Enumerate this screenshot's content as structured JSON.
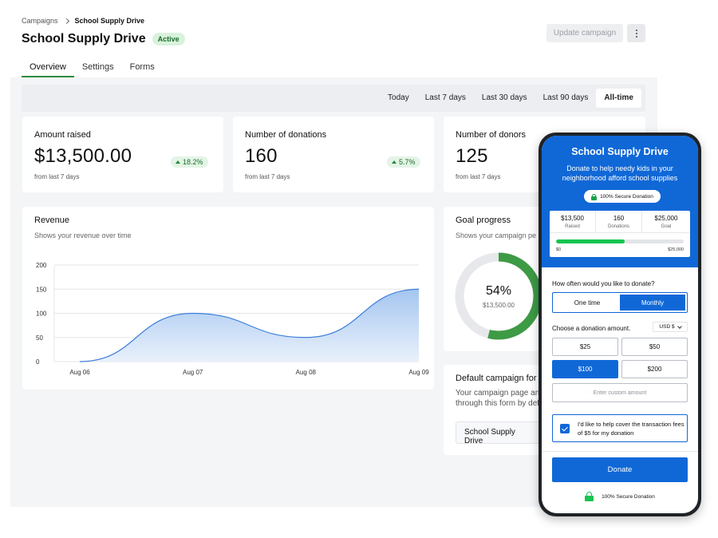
{
  "breadcrumb": {
    "parent": "Campaigns",
    "current": "School Supply Drive"
  },
  "header": {
    "title": "School Supply Drive",
    "status": "Active",
    "update_label": "Update campaign"
  },
  "tabs": [
    {
      "label": "Overview"
    },
    {
      "label": "Settings"
    },
    {
      "label": "Forms"
    }
  ],
  "date_ranges": [
    {
      "label": "Today"
    },
    {
      "label": "Last 7 days"
    },
    {
      "label": "Last 30 days"
    },
    {
      "label": "Last 90 days"
    },
    {
      "label": "All-time"
    }
  ],
  "date_range_selected": "All-time",
  "stats": [
    {
      "label": "Amount raised",
      "value": "$13,500.00",
      "change": "18.2%",
      "sub": "from last 7 days"
    },
    {
      "label": "Number of donations",
      "value": "160",
      "change": "5.7%",
      "sub": "from last 7 days"
    },
    {
      "label": "Number of donors",
      "value": "125",
      "sub": "from last 7 days"
    }
  ],
  "revenue": {
    "title": "Revenue",
    "subtitle": "Shows your revenue over time"
  },
  "chart_data": {
    "type": "area",
    "x": [
      "Aug 06",
      "Aug 07",
      "Aug 08",
      "Aug 09"
    ],
    "series": [
      {
        "values": [
          0,
          100,
          50,
          150
        ]
      }
    ],
    "ylim": [
      0,
      200
    ],
    "yticks": [
      0,
      50,
      100,
      150,
      200
    ],
    "grid": true,
    "color": "#3d7fd9"
  },
  "goal": {
    "title": "Goal progress",
    "subtitle": "Shows your campaign pe",
    "percent_label": "54%",
    "percent": 54,
    "amount": "$13,500.00",
    "color": "#3d9a45"
  },
  "default_form": {
    "title": "Default campaign for",
    "desc_line1": "Your campaign page and",
    "desc_line2": "through this form by defa",
    "selected": "School Supply Drive"
  },
  "donation_form": {
    "title": "School Supply Drive",
    "description": "Donate to help needy kids in your neighborhood afford school supplies",
    "secure_badge": "100% Secure Donation",
    "raised_value": "$13,500",
    "raised_label": "Raised",
    "donations_value": "160",
    "donations_label": "Donations",
    "goal_value": "$25,000",
    "goal_label": "Goal",
    "progress_fraction": 0.54,
    "progress_min": "$0",
    "progress_max": "$25,000",
    "frequency_question": "How often would you like to donate?",
    "frequency_options": [
      {
        "label": "One time"
      },
      {
        "label": "Monthly"
      }
    ],
    "frequency_selected": "Monthly",
    "amount_question": "Choose a donation amount.",
    "currency": "USD $",
    "amounts": [
      {
        "label": "$25"
      },
      {
        "label": "$50"
      },
      {
        "label": "$100"
      },
      {
        "label": "$200"
      }
    ],
    "amount_selected": "$100",
    "custom_placeholder": "Enter custom amount",
    "fee_text": "I'd like to help cover the transaction fees of $5 for my donation",
    "donate_label": "Donate",
    "footer_secure": "100% Secure Donation",
    "brand_color": "#1068d7"
  }
}
